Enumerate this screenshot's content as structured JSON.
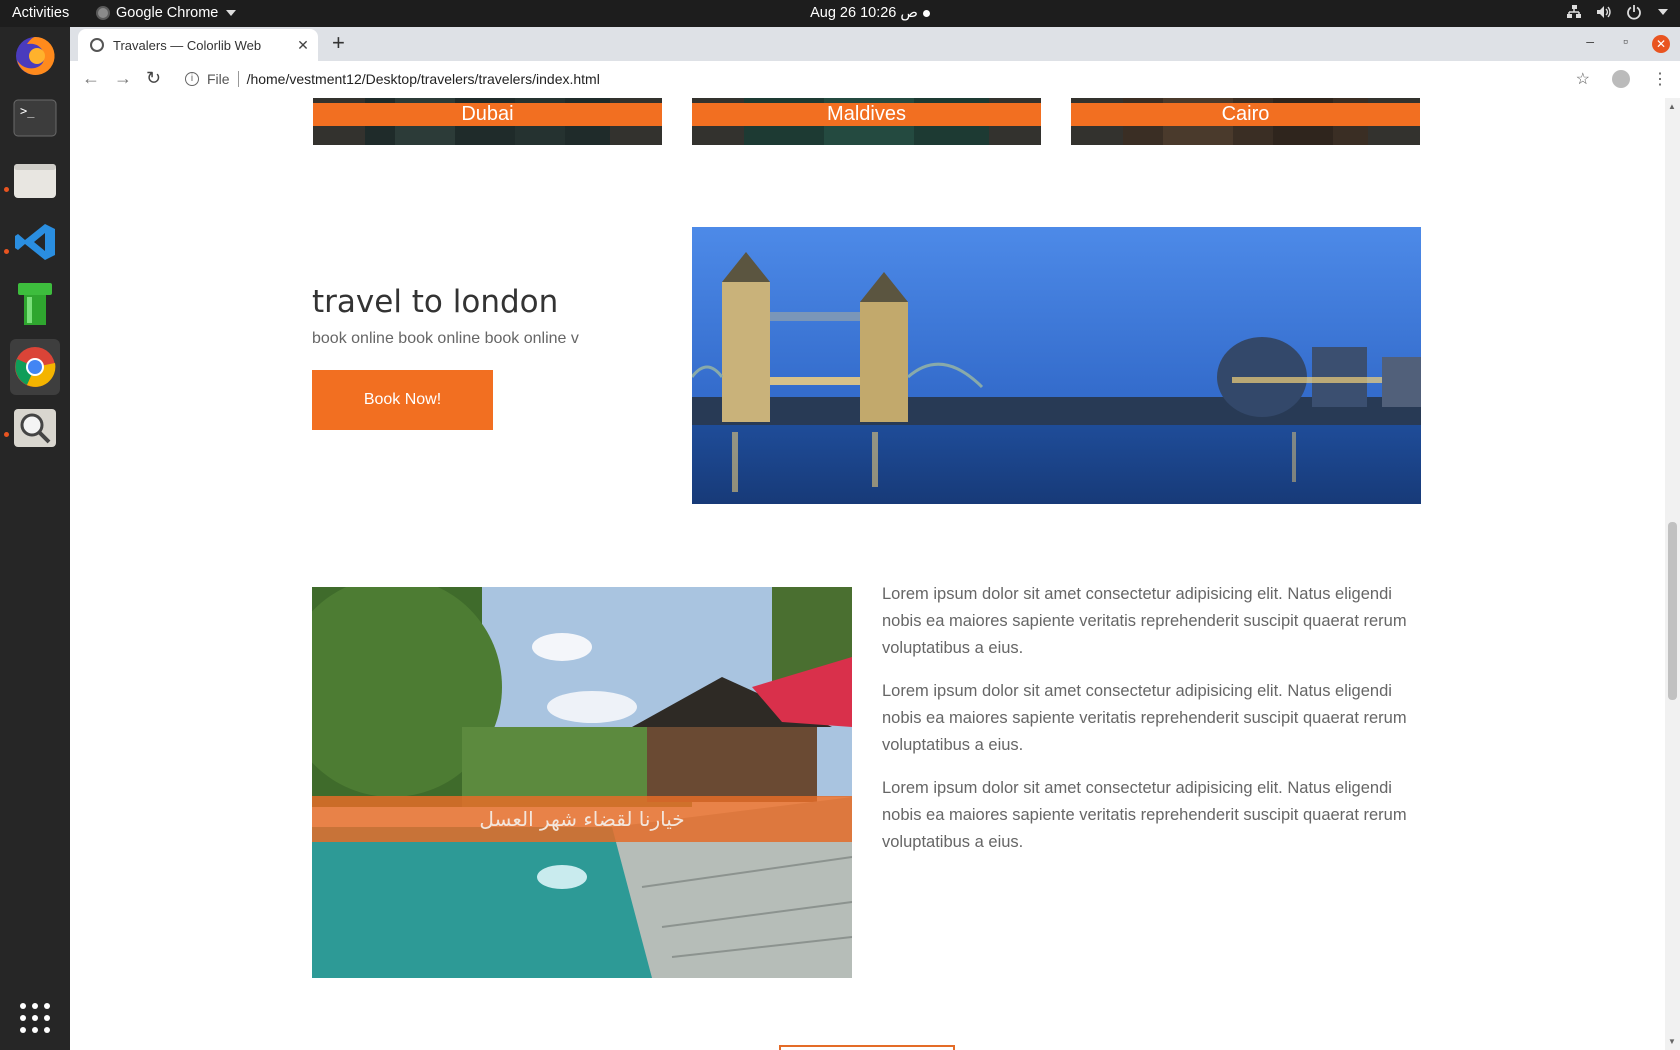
{
  "system": {
    "activities": "Activities",
    "app_name": "Google Chrome",
    "clock": "Aug 26  10:26 ص"
  },
  "browser": {
    "tab_title": "Travalers — Colorlib Web",
    "url_scheme": "File",
    "url": "/home/vestment12/Desktop/travelers/travelers/index.html"
  },
  "cities": [
    {
      "name": "Dubai"
    },
    {
      "name": "Maldives"
    },
    {
      "name": "Cairo"
    }
  ],
  "london": {
    "title": "travel to london",
    "subtitle": "book online book online book online v",
    "button": "Book Now!"
  },
  "honeymoon": {
    "caption": "خيارنا لقضاء شهر العسل",
    "paragraphs": [
      "Lorem ipsum dolor sit amet consectetur adipisicing elit. Natus eligendi nobis ea maiores sapiente veritatis reprehenderit suscipit quaerat rerum voluptatibus a eius.",
      "Lorem ipsum dolor sit amet consectetur adipisicing elit. Natus eligendi nobis ea maiores sapiente veritatis reprehenderit suscipit quaerat rerum voluptatibus a eius.",
      "Lorem ipsum dolor sit amet consectetur adipisicing elit. Natus eligendi nobis ea maiores sapiente veritatis reprehenderit suscipit quaerat rerum voluptatibus a eius."
    ]
  },
  "colors": {
    "accent": "#f26f21",
    "topbar": "#1d1d1d",
    "dock": "#262626"
  }
}
